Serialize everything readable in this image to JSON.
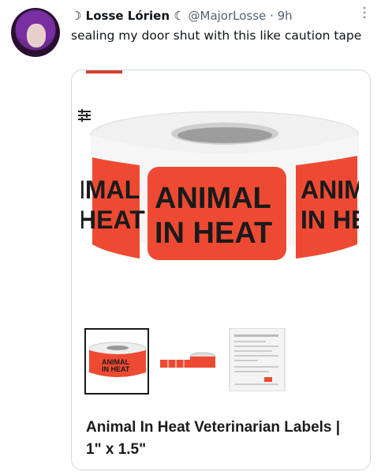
{
  "tweet": {
    "name": "☽ Losse Lórien ☾",
    "handle": "@MajorLosse",
    "separator": "·",
    "time": "9h",
    "text": "sealing my door shut with this like caution tape"
  },
  "card": {
    "title": "Animal In Heat Veterinarian Labels | 1\" x 1.5\"",
    "label_line1": "ANIMAL",
    "label_line2": "IN HEAT",
    "left_partial1": "IMAL",
    "left_partial2": "HEAT",
    "right_partial1": "ANIMA",
    "right_partial2": "IN HE",
    "label_color": "#ee4a33",
    "thumb_label1": "ANIMAL",
    "thumb_label2": "IN HEAT"
  },
  "icons": {
    "more": "more-icon",
    "filter": "filter-icon"
  }
}
